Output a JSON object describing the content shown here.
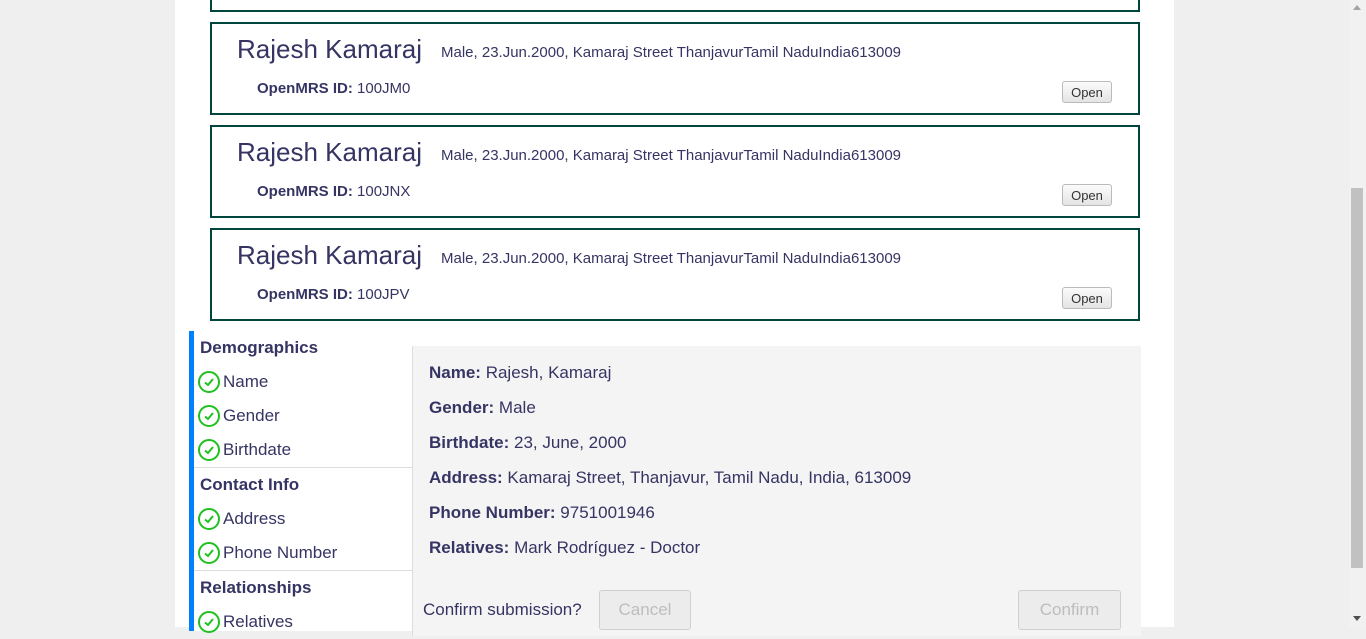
{
  "results": [
    {
      "name": "Rajesh Kamaraj",
      "info": "Male, 23.Jun.2000, Kamaraj Street ThanjavurTamil NaduIndia613009",
      "id_label": "OpenMRS ID:",
      "id_value": "100JM0",
      "open_label": "Open"
    },
    {
      "name": "Rajesh Kamaraj",
      "info": "Male, 23.Jun.2000, Kamaraj Street ThanjavurTamil NaduIndia613009",
      "id_label": "OpenMRS ID:",
      "id_value": "100JNX",
      "open_label": "Open"
    },
    {
      "name": "Rajesh Kamaraj",
      "info": "Male, 23.Jun.2000, Kamaraj Street ThanjavurTamil NaduIndia613009",
      "id_label": "OpenMRS ID:",
      "id_value": "100JPV",
      "open_label": "Open"
    }
  ],
  "sidebar": {
    "sections": [
      {
        "title": "Demographics",
        "items": [
          "Name",
          "Gender",
          "Birthdate"
        ]
      },
      {
        "title": "Contact Info",
        "items": [
          "Address",
          "Phone Number"
        ]
      },
      {
        "title": "Relationships",
        "items": [
          "Relatives"
        ]
      }
    ]
  },
  "summary": {
    "name_label": "Name:",
    "name_value": "Rajesh, Kamaraj",
    "gender_label": "Gender:",
    "gender_value": "Male",
    "birthdate_label": "Birthdate:",
    "birthdate_value": "23, June, 2000",
    "address_label": "Address:",
    "address_value": "Kamaraj Street, Thanjavur, Tamil Nadu, India, 613009",
    "phone_label": "Phone Number:",
    "phone_value": "9751001946",
    "relatives_label": "Relatives:",
    "relatives_value": "Mark Rodríguez - Doctor"
  },
  "confirm": {
    "question": "Confirm submission?",
    "cancel_label": "Cancel",
    "confirm_label": "Confirm"
  },
  "colors": {
    "card_border": "#00463f",
    "text": "#363463",
    "sidebar_accent": "#007fff",
    "check": "#20c020"
  }
}
